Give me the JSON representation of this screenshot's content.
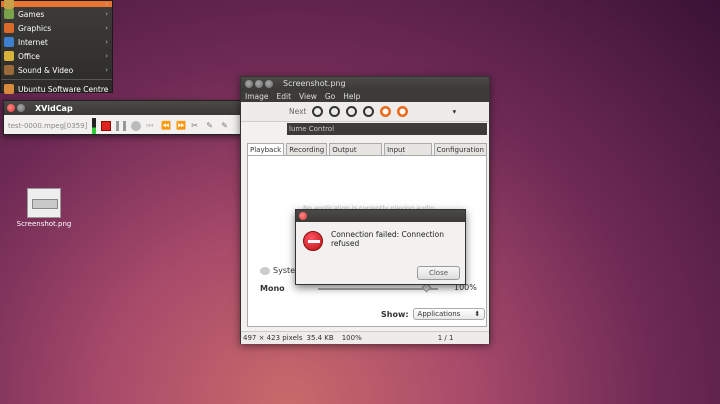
{
  "app_menu": {
    "items": [
      {
        "label": "",
        "icon": "accessories-icon",
        "color": "#c9a04a"
      },
      {
        "label": "Games",
        "icon": "games-icon",
        "color": "#7aa24a"
      },
      {
        "label": "Graphics",
        "icon": "graphics-icon",
        "color": "#d96a2a"
      },
      {
        "label": "Internet",
        "icon": "internet-icon",
        "color": "#3f7fcf"
      },
      {
        "label": "Office",
        "icon": "office-icon",
        "color": "#d9b23a"
      },
      {
        "label": "Sound & Video",
        "icon": "sound-video-icon",
        "color": "#9a6a3a"
      }
    ],
    "software_centre": "Ubuntu Software Centre"
  },
  "xvidcap": {
    "title": "XVidCap",
    "file": "test-0000.mpeg[0359]"
  },
  "desktop_icon": {
    "label": "Screenshot.png"
  },
  "viewer": {
    "title": "Screenshot.png",
    "menu": [
      "Image",
      "Edit",
      "View",
      "Go",
      "Help"
    ],
    "toolbar_next": "Next",
    "volume_header": "lume Control",
    "tabs": [
      "Playback",
      "Recording",
      "Output Devices",
      "Input Devices",
      "Configuration"
    ],
    "hidden_text": "No application is currently playing audio.",
    "system_label": "Syster",
    "mono_label": "Mono",
    "percent": "100%",
    "show_label": "Show:",
    "show_value": "Applications",
    "status_dims": "497 × 423 pixels",
    "status_size": "35.4 KB",
    "status_zoom": "100%",
    "status_page": "1 / 1"
  },
  "dialog": {
    "message": "Connection failed: Connection refused",
    "close_label": "Close"
  }
}
